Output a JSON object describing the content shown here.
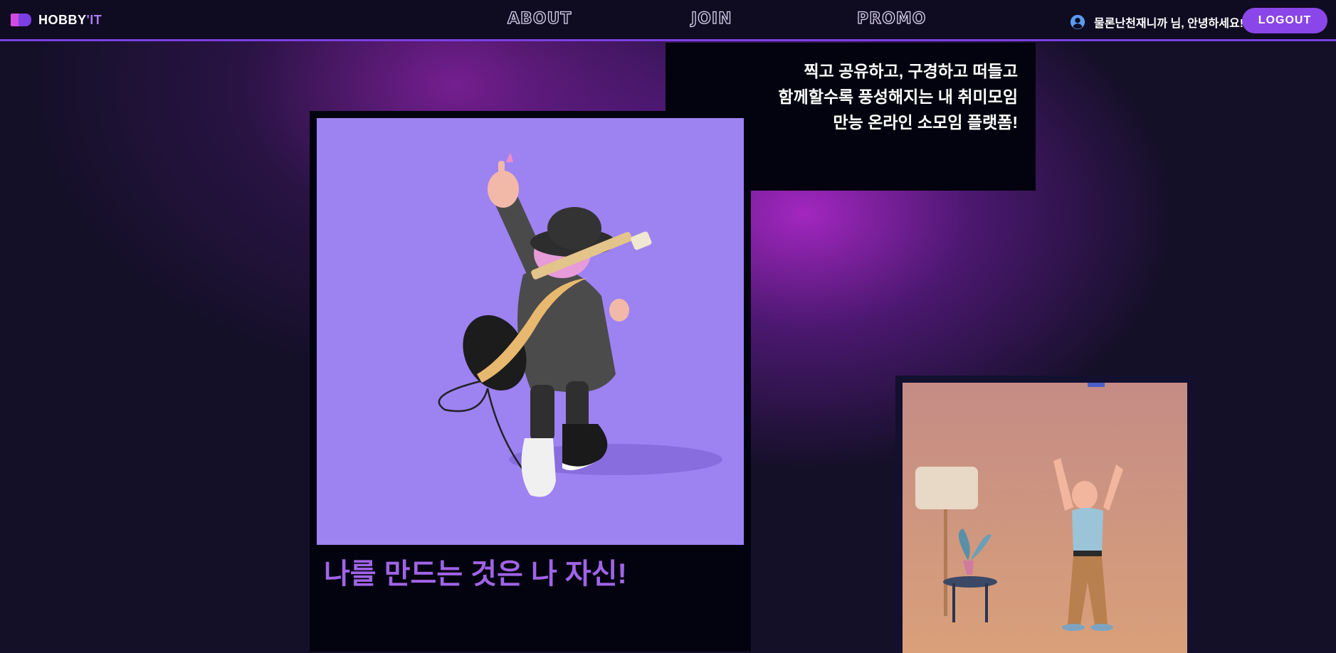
{
  "brand": {
    "name_main": "HOBBY",
    "name_accent": "'IT"
  },
  "nav": {
    "links": [
      {
        "label": "ABOUT"
      },
      {
        "label": "JOIN"
      },
      {
        "label": "PROMO"
      }
    ],
    "greeting": "물론난천재니까 님, 안녕하세요!",
    "logout_label": "LOGOUT"
  },
  "intro": {
    "lines": [
      "찍고 공유하고, 구경하고 떠들고",
      "함께할수록 풍성해지는 내 취미모임",
      "만능 온라인 소모임 플랫폼!"
    ]
  },
  "main_card": {
    "title": "나를 만드는 것은 나 자신!"
  },
  "colors": {
    "accent": "#8a46e8",
    "nav_bg": "#0f0b20",
    "card_bg": "#03030f",
    "card_image_bg": "#9d82f2",
    "title_color": "#a064e6",
    "side_image_bg": "#c99080"
  },
  "icons": [
    "user-circle-icon",
    "logo-mark-icon"
  ]
}
